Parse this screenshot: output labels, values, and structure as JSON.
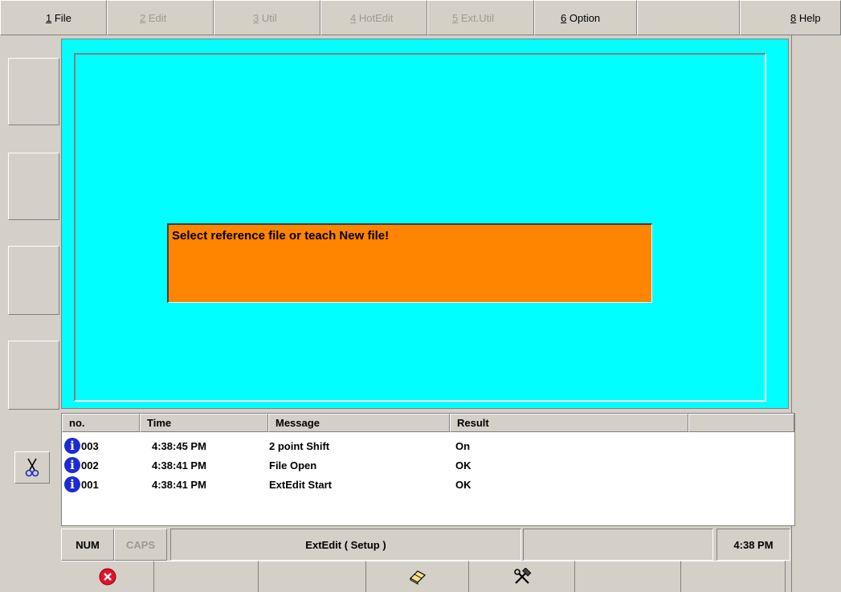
{
  "menu": {
    "items": [
      {
        "hotkey": "1",
        "label": "File",
        "enabled": true
      },
      {
        "hotkey": "2",
        "label": "Edit",
        "enabled": false
      },
      {
        "hotkey": "3",
        "label": "Util",
        "enabled": false
      },
      {
        "hotkey": "4",
        "label": "HotEdit",
        "enabled": false
      },
      {
        "hotkey": "5",
        "label": "Ext.Util",
        "enabled": false
      },
      {
        "hotkey": "6",
        "label": "Option",
        "enabled": true
      },
      {
        "hotkey": "",
        "label": "",
        "enabled": false
      },
      {
        "hotkey": "8",
        "label": "Help",
        "enabled": true
      }
    ]
  },
  "main": {
    "message": "Select reference file or teach New file!",
    "background_color": "#00ffff",
    "message_color": "#ff8400"
  },
  "log": {
    "columns": [
      "no.",
      "Time",
      "Message",
      "Result",
      ""
    ],
    "rows": [
      {
        "icon": "info-icon",
        "no": "003",
        "time": "4:38:45 PM",
        "message": " 2 point Shift",
        "result": "On"
      },
      {
        "icon": "info-icon",
        "no": "002",
        "time": "4:38:41 PM",
        "message": "File Open",
        "result": "OK"
      },
      {
        "icon": "info-icon",
        "no": "001",
        "time": "4:38:41 PM",
        "message": "ExtEdit Start",
        "result": "OK"
      }
    ]
  },
  "status": {
    "num": "NUM",
    "caps": "CAPS",
    "mode": "ExtEdit ( Setup )",
    "extra": "",
    "clock": "4:38 PM"
  },
  "toolbar": {
    "buttons": [
      {
        "icon": "close-circle-icon"
      },
      {
        "icon": ""
      },
      {
        "icon": ""
      },
      {
        "icon": "eraser-icon"
      },
      {
        "icon": "tools-icon"
      },
      {
        "icon": ""
      },
      {
        "icon": ""
      }
    ]
  },
  "side": {
    "cut_icon": "scissors-icon"
  }
}
